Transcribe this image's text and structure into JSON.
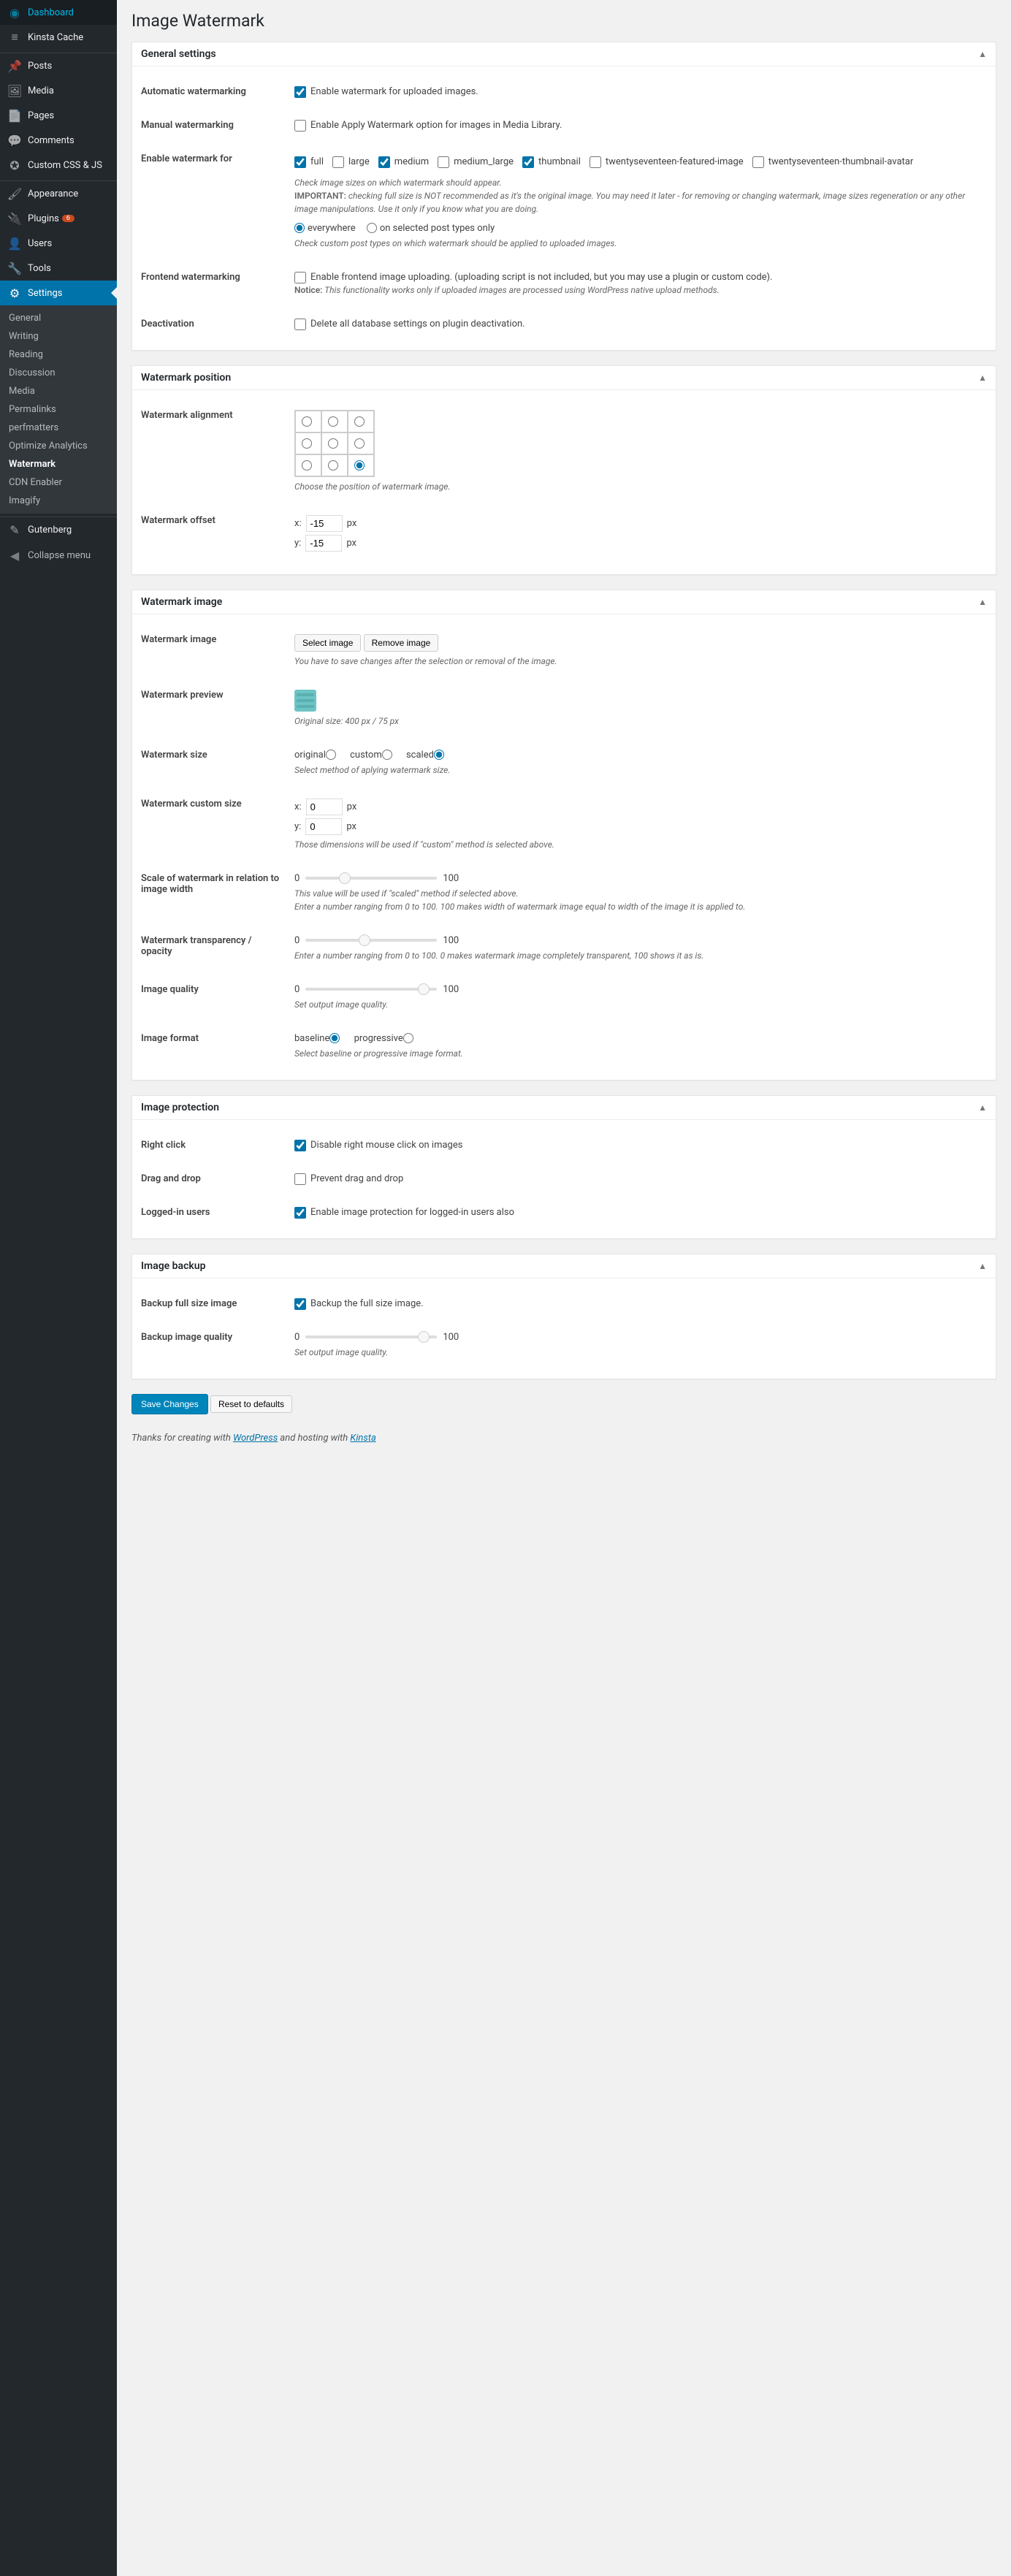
{
  "page_title": "Image Watermark",
  "sidebar": {
    "items": [
      {
        "icon": "◉",
        "label": "Dashboard"
      },
      {
        "icon": "≡",
        "label": "Kinsta Cache"
      },
      {
        "icon": "📌",
        "label": "Posts"
      },
      {
        "icon": "🖼",
        "label": "Media"
      },
      {
        "icon": "📄",
        "label": "Pages"
      },
      {
        "icon": "💬",
        "label": "Comments"
      },
      {
        "icon": "✪",
        "label": "Custom CSS & JS"
      },
      {
        "icon": "🖌",
        "label": "Appearance"
      },
      {
        "icon": "🔌",
        "label": "Plugins",
        "badge": "6"
      },
      {
        "icon": "👤",
        "label": "Users"
      },
      {
        "icon": "🔧",
        "label": "Tools"
      },
      {
        "icon": "⚙",
        "label": "Settings",
        "current": true
      }
    ],
    "submenu": [
      "General",
      "Writing",
      "Reading",
      "Discussion",
      "Media",
      "Permalinks",
      "perfmatters",
      "Optimize Analytics",
      "Watermark",
      "CDN Enabler",
      "Imagify"
    ],
    "submenu_current": "Watermark",
    "gutenberg": {
      "icon": "✎",
      "label": "Gutenberg"
    },
    "collapse": "Collapse menu"
  },
  "sections": {
    "general": {
      "title": "General settings",
      "auto_label": "Automatic watermarking",
      "auto_text": "Enable watermark for uploaded images.",
      "manual_label": "Manual watermarking",
      "manual_text": "Enable Apply Watermark option for images in Media Library.",
      "enable_label": "Enable watermark for",
      "sizes": [
        "full",
        "large",
        "medium",
        "medium_large",
        "thumbnail",
        "twentyseventeen-featured-image",
        "twentyseventeen-thumbnail-avatar"
      ],
      "sizes_desc": "Check image sizes on which watermark should appear.",
      "important": "IMPORTANT:",
      "important_text": " checking full size is NOT recommended as it's the original image. You may need it later - for removing or changing watermark, image sizes regeneration or any other image manipulations. Use it only if you know what you are doing.",
      "everywhere": "everywhere",
      "selected_types": "on selected post types only",
      "cpt_desc": "Check custom post types on which watermark should be applied to uploaded images.",
      "frontend_label": "Frontend watermarking",
      "frontend_text": "Enable frontend image uploading. (uploading script is not included, but you may use a plugin or custom code).",
      "notice": "Notice:",
      "notice_text": " This functionality works only if uploaded images are processed using WordPress native upload methods.",
      "deactivation_label": "Deactivation",
      "deactivation_text": "Delete all database settings on plugin deactivation."
    },
    "position": {
      "title": "Watermark position",
      "align_label": "Watermark alignment",
      "align_desc": "Choose the position of watermark image.",
      "offset_label": "Watermark offset",
      "x_label": "x:",
      "y_label": "y:",
      "x_val": "-15",
      "y_val": "-15",
      "px": "px"
    },
    "image": {
      "title": "Watermark image",
      "img_label": "Watermark image",
      "select_btn": "Select image",
      "remove_btn": "Remove image",
      "img_desc": "You have to save changes after the selection or removal of the image.",
      "preview_label": "Watermark preview",
      "preview_desc": "Original size: 400 px / 75 px",
      "size_label": "Watermark size",
      "original": "original",
      "custom": "custom",
      "scaled": "scaled",
      "size_desc": "Select method of aplying watermark size.",
      "custom_label": "Watermark custom size",
      "custom_x": "0",
      "custom_y": "0",
      "custom_desc": "Those dimensions will be used if \"custom\" method is selected above.",
      "scale_label": "Scale of watermark in relation to image width",
      "scale_desc1": "This value will be used if \"scaled\" method if selected above.",
      "scale_desc2": "Enter a number ranging from 0 to 100. 100 makes width of watermark image equal to width of the image it is applied to.",
      "trans_label": "Watermark transparency / opacity",
      "trans_desc": "Enter a number ranging from 0 to 100. 0 makes watermark image completely transparent, 100 shows it as is.",
      "quality_label": "Image quality",
      "quality_desc": "Set output image quality.",
      "format_label": "Image format",
      "baseline": "baseline",
      "progressive": "progressive",
      "format_desc": "Select baseline or progressive image format.",
      "zero": "0",
      "hundred": "100"
    },
    "protection": {
      "title": "Image protection",
      "right_label": "Right click",
      "right_text": "Disable right mouse click on images",
      "drag_label": "Drag and drop",
      "drag_text": "Prevent drag and drop",
      "logged_label": "Logged-in users",
      "logged_text": "Enable image protection for logged-in users also"
    },
    "backup": {
      "title": "Image backup",
      "full_label": "Backup full size image",
      "full_text": "Backup the full size image.",
      "quality_label": "Backup image quality",
      "quality_desc": "Set output image quality."
    }
  },
  "buttons": {
    "save": "Save Changes",
    "reset": "Reset to defaults"
  },
  "footer": {
    "prefix": "Thanks for creating with ",
    "wp": "WordPress",
    "mid": " and hosting with ",
    "kinsta": "Kinsta"
  }
}
